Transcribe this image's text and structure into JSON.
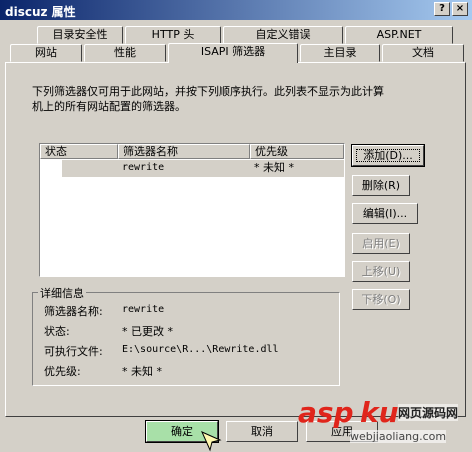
{
  "window": {
    "title": "discuz 属性",
    "help_button": "?",
    "close_button": "×"
  },
  "tabs_back": [
    "目录安全性",
    "HTTP 头",
    "自定义错误",
    "ASP.NET"
  ],
  "tabs_front": [
    "网站",
    "性能",
    "ISAPI 筛选器",
    "主目录",
    "文档"
  ],
  "description": {
    "line1": "下列筛选器仅可用于此网站，并按下列顺序执行。此列表不显示为此计算",
    "line2": "机上的所有网站配置的筛选器。"
  },
  "filter_table": {
    "headers": [
      "状态",
      "筛选器名称",
      "优先级"
    ],
    "rows": [
      {
        "status": "",
        "name": "rewrite",
        "priority": "* 未知 *"
      }
    ]
  },
  "side_buttons": {
    "add": "添加(D)...",
    "remove": "删除(R)",
    "edit": "编辑(I)...",
    "enable": "启用(E)",
    "move_up": "上移(U)",
    "move_down": "下移(O)"
  },
  "details": {
    "legend": "详细信息",
    "name_label": "筛选器名称:",
    "name_value": "rewrite",
    "status_label": "状态:",
    "status_value": "* 已更改 *",
    "exe_label": "可执行文件:",
    "exe_value": "E:\\source\\R...\\Rewrite.dll",
    "priority_label": "优先级:",
    "priority_value": "* 未知 *"
  },
  "bottom_buttons": {
    "ok": "确定",
    "cancel": "取消",
    "apply": "应用"
  },
  "watermark": {
    "text1": "asp",
    "text2": "ku",
    "sub": "网页源码网",
    "url": "webjiaoliang.com"
  },
  "colors": {
    "title_start": "#0a246a",
    "title_end": "#a6caf0",
    "ok_button": "#a8e0a8",
    "watermark_red": "#e0251b"
  }
}
